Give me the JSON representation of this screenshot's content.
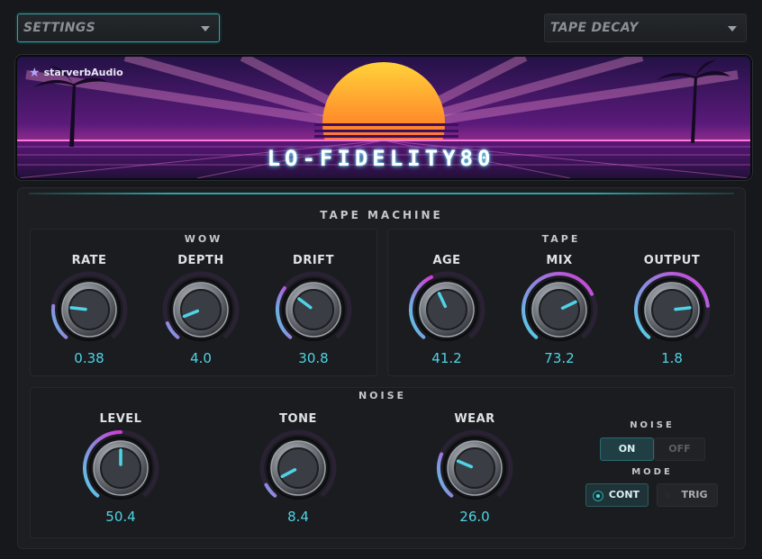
{
  "header": {
    "settings_label": "SETTINGS",
    "preset_label": "TAPE DECAY"
  },
  "banner": {
    "brand": "starverbAudio",
    "title": "LO-FIDELITY80"
  },
  "tape_machine": {
    "title": "TAPE MACHINE",
    "wow": {
      "title": "WOW",
      "knobs": [
        {
          "label": "RATE",
          "value": "0.38",
          "level": 0.2
        },
        {
          "label": "DEPTH",
          "value": "4.0",
          "level": 0.1
        },
        {
          "label": "DRIFT",
          "value": "30.8",
          "level": 0.31
        }
      ]
    },
    "tape": {
      "title": "TAPE",
      "knobs": [
        {
          "label": "AGE",
          "value": "41.2",
          "level": 0.41
        },
        {
          "label": "MIX",
          "value": "73.2",
          "level": 0.73
        },
        {
          "label": "OUTPUT",
          "value": "1.8",
          "level": 0.8
        }
      ]
    }
  },
  "noise": {
    "title": "NOISE",
    "knobs": [
      {
        "label": "LEVEL",
        "value": "50.4",
        "level": 0.5
      },
      {
        "label": "TONE",
        "value": "8.4",
        "level": 0.08
      },
      {
        "label": "WEAR",
        "value": "26.0",
        "level": 0.26
      }
    ],
    "switch": {
      "title": "NOISE",
      "on_label": "ON",
      "off_label": "OFF",
      "state": "ON"
    },
    "mode": {
      "title": "MODE",
      "cont_label": "CONT",
      "trig_label": "TRIG",
      "state": "CONT"
    }
  },
  "colors": {
    "accent": "#4fd3e6",
    "arc_magenta": "#d23ad6",
    "frame_teal": "#2fa5a8"
  }
}
